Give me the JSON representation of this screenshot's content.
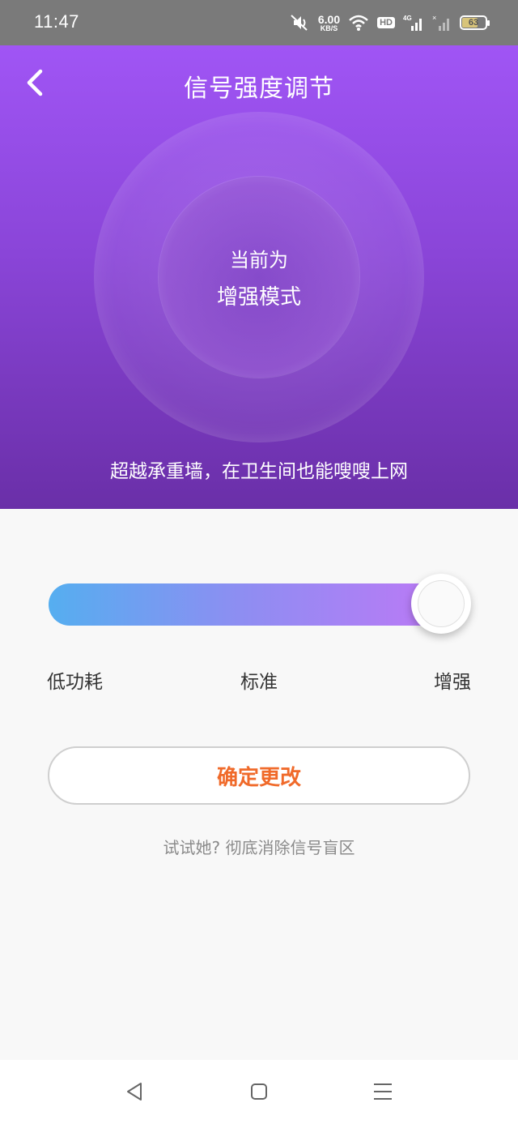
{
  "status_bar": {
    "time": "11:47",
    "speed_value": "6.00",
    "speed_unit": "KB/S",
    "hd_badge": "HD",
    "network_label": "4G",
    "battery_level": "63",
    "icons": [
      "mute-icon",
      "wifi-icon",
      "signal-icon",
      "signal-off-icon",
      "battery-icon"
    ]
  },
  "header": {
    "title": "信号强度调节",
    "back_icon": "chevron-left-icon"
  },
  "hero": {
    "mode_line1": "当前为",
    "mode_line2": "增强模式",
    "tagline": "超越承重墙，在卫生间也能嗖嗖上网"
  },
  "slider": {
    "labels": [
      "低功耗",
      "标准",
      "增强"
    ],
    "selected_index": 2,
    "value_fraction": 1.0,
    "gradient_start": "#55aef0",
    "gradient_end": "#c276f6"
  },
  "confirm_button": {
    "label": "确定更改",
    "color": "#f06a2a"
  },
  "footer_link": {
    "text": "试试她? 彻底消除信号盲区"
  },
  "nav_bar": {
    "icons": [
      "back-triangle-icon",
      "home-square-icon",
      "menu-lines-icon"
    ]
  },
  "colors": {
    "hero_top": "#a055f5",
    "hero_bottom": "#6a2fa8",
    "page_bg": "#f8f8f8"
  }
}
